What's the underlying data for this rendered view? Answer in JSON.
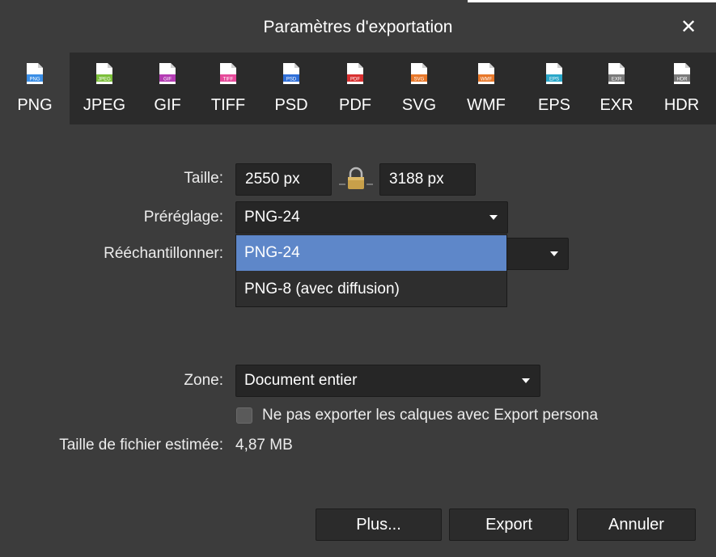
{
  "dialog": {
    "title": "Paramètres d'exportation"
  },
  "formats": [
    {
      "label": "PNG",
      "tag": "PNG",
      "color": "#3a8ee6",
      "active": true
    },
    {
      "label": "JPEG",
      "tag": "JPEG",
      "color": "#7cbf3a",
      "active": false
    },
    {
      "label": "GIF",
      "tag": "GIF",
      "color": "#b43cb4",
      "active": false
    },
    {
      "label": "TIFF",
      "tag": "TIFF",
      "color": "#e64a9a",
      "active": false
    },
    {
      "label": "PSD",
      "tag": "PSD",
      "color": "#2f6fd8",
      "active": false
    },
    {
      "label": "PDF",
      "tag": "PDF",
      "color": "#d83030",
      "active": false
    },
    {
      "label": "SVG",
      "tag": "SVG",
      "color": "#e8782a",
      "active": false
    },
    {
      "label": "WMF",
      "tag": "WMF",
      "color": "#e8782a",
      "active": false
    },
    {
      "label": "EPS",
      "tag": "EPS",
      "color": "#2aa7c9",
      "active": false
    },
    {
      "label": "EXR",
      "tag": "EXR",
      "color": "#7a7a7a",
      "active": false
    },
    {
      "label": "HDR",
      "tag": "HDR",
      "color": "#7a7a7a",
      "active": false
    }
  ],
  "size": {
    "label": "Taille:",
    "width": "2550 px",
    "height": "3188 px"
  },
  "preset": {
    "label": "Préréglage:",
    "value": "PNG-24",
    "options": [
      "PNG-24",
      "PNG-8 (avec diffusion)"
    ]
  },
  "resample": {
    "label": "Rééchantillonner:"
  },
  "zone": {
    "label": "Zone:",
    "value": "Document entier"
  },
  "layers_checkbox": {
    "label": "Ne pas exporter les calques avec Export persona"
  },
  "filesize": {
    "label": "Taille de fichier estimée:",
    "value": "4,87 MB"
  },
  "buttons": {
    "more": "Plus...",
    "export": "Export",
    "cancel": "Annuler"
  },
  "colors": {
    "accent": "#5e87c9",
    "panel": "#3c3c3c",
    "toolbar": "#2b2b2b",
    "lock": "#c8a04a"
  }
}
